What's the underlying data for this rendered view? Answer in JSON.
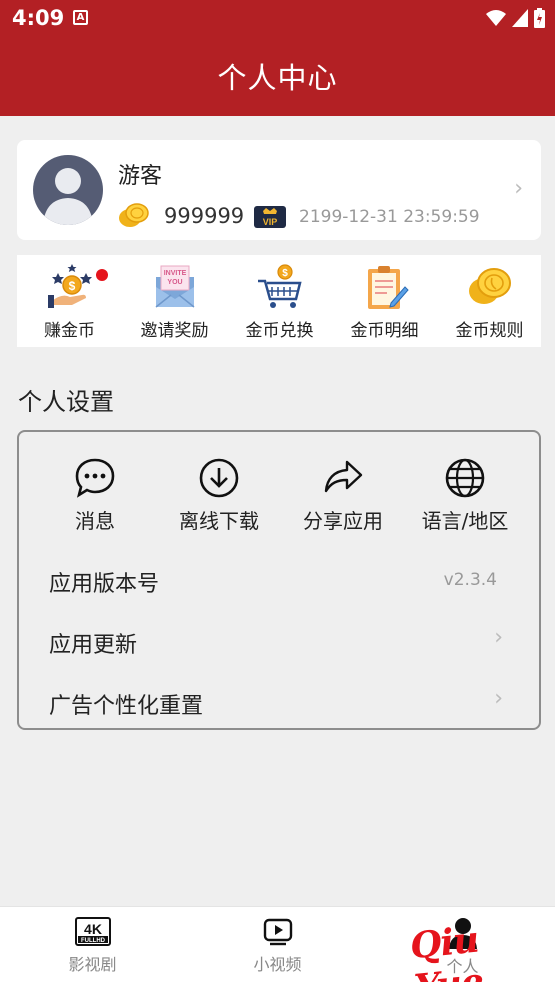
{
  "status_bar": {
    "time": "4:09",
    "notification_icon": "A"
  },
  "header": {
    "title": "个人中心"
  },
  "profile": {
    "username": "游客",
    "coins": "999999",
    "vip_expire": "2199-12-31 23:59:59"
  },
  "features": [
    {
      "label": "赚金币",
      "icon": "earn-coins-icon",
      "badge": true
    },
    {
      "label": "邀请奖励",
      "icon": "invite-envelope-icon"
    },
    {
      "label": "金币兑换",
      "icon": "coin-cart-icon"
    },
    {
      "label": "金币明细",
      "icon": "clipboard-icon"
    },
    {
      "label": "金币规则",
      "icon": "coins-icon"
    }
  ],
  "settings": {
    "title": "个人设置",
    "quick_actions": [
      {
        "label": "消息",
        "icon": "message-icon"
      },
      {
        "label": "离线下载",
        "icon": "download-icon"
      },
      {
        "label": "分享应用",
        "icon": "share-icon"
      },
      {
        "label": "语言/地区",
        "icon": "globe-icon"
      }
    ],
    "rows": [
      {
        "label": "应用版本号",
        "value": "v2.3.4"
      },
      {
        "label": "应用更新"
      },
      {
        "label": "广告个性化重置"
      }
    ]
  },
  "bottom_nav": [
    {
      "label": "影视剧",
      "icon": "4k-icon"
    },
    {
      "label": "小视频",
      "icon": "play-icon"
    },
    {
      "label": "个人",
      "icon": "person-icon",
      "active": true
    }
  ],
  "watermark": "Qiu Yue",
  "colors": {
    "brand": "#b32024",
    "accent_red": "#e5141c"
  }
}
